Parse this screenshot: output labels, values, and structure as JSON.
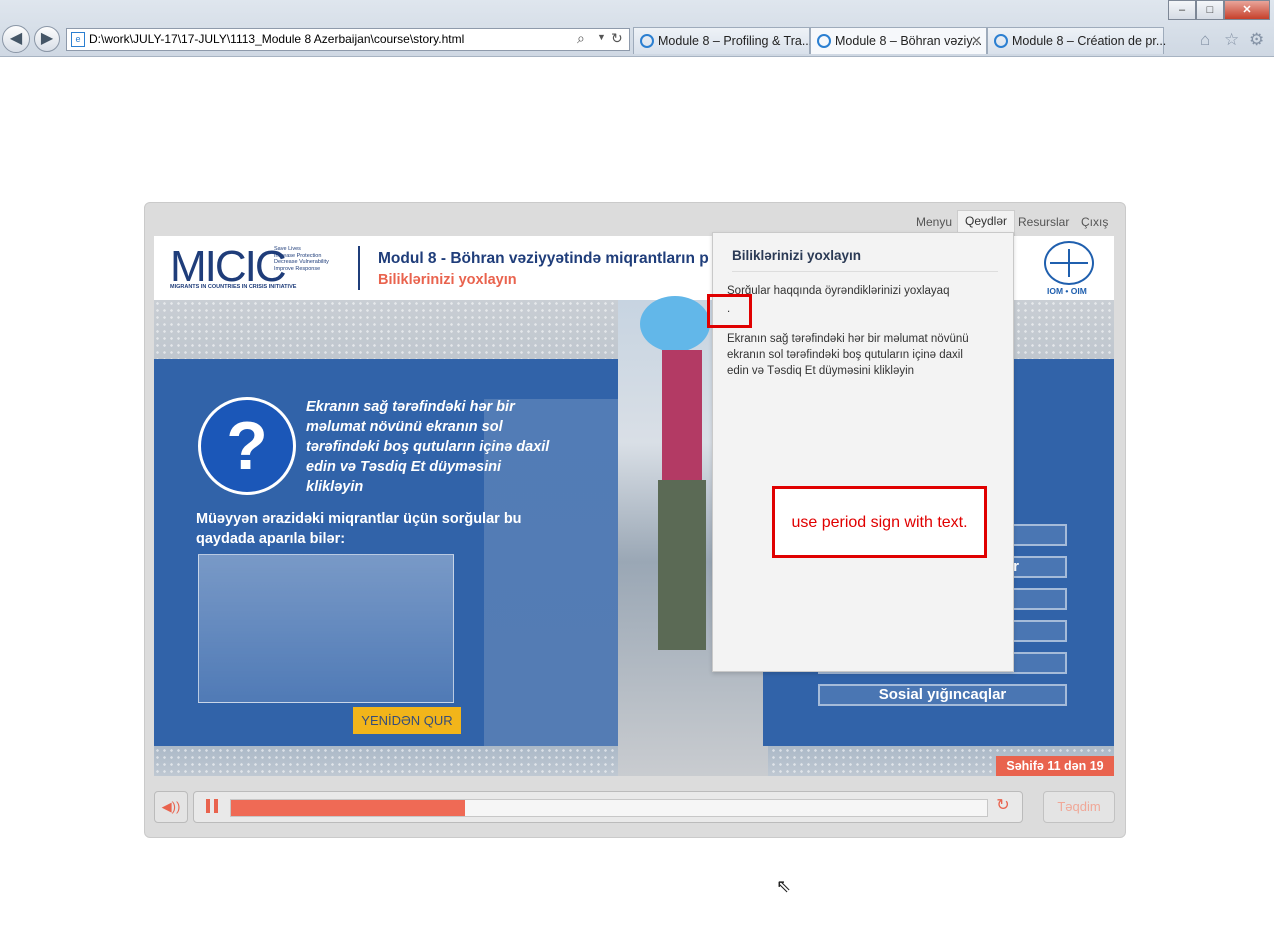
{
  "browser": {
    "address": "D:\\work\\JULY-17\\17-JULY\\1113_Module 8 Azerbaijan\\course\\story.html",
    "tabs": [
      {
        "label": "Module 8 – Profiling & Tra...",
        "active": false
      },
      {
        "label": "Module 8 – Böhran vəziy...",
        "active": true
      },
      {
        "label": "Module 8 – Création de pr...",
        "active": false
      }
    ],
    "window_buttons": {
      "minimize": "–",
      "maximize": "□",
      "close": "✕"
    }
  },
  "player_menu": {
    "menu": "Menyu",
    "notes": "Qeydlər",
    "resources": "Resurslar",
    "exit": "Çıxış"
  },
  "header": {
    "logo": "MICIC",
    "logo_sub": "MIGRANTS IN COUNTRIES IN CRISIS INITIATIVE",
    "logo_lines": [
      "Save Lives",
      "Increase Protection",
      "Decrease Vulnerability",
      "Improve Response"
    ],
    "title": "Modul 8 - Böhran vəziyyətində miqrantların p",
    "subtitle": "Biliklərinizi yoxlayın",
    "org": "IOM • OIM"
  },
  "slide": {
    "instruction": "Ekranın sağ tərəfindəki hər bir məlumat növünü ekranın sol tərəfindəki boş qutuların içinə daxil edin və Təsdiq Et düyməsini klikləyin",
    "question": "Müəyyən ərazidəki miqrantlar üçün sorğular bu qaydada aparıla bilər:",
    "reset": "YENİDƏN QUR",
    "page": "Səhifə 11 dən 19",
    "drag_items": [
      "",
      "r",
      "",
      "",
      "",
      "Sosial yığıncaqlar"
    ]
  },
  "notes": {
    "title": "Biliklərinizi yoxlayın",
    "para1": "Sorğular haqqında  öyrəndiklərinizi yoxlayaq",
    "dot": ".",
    "para2": "Ekranın sağ tərəfindəki hər bir məlumat növünü ekranın sol tərəfindəki boş qutuların içinə daxil edin və Təsdiq Et düyməsini klikləyin"
  },
  "annotation": {
    "text": "use period sign with text."
  },
  "controls": {
    "progress": 0.31,
    "submit": "Təqdim"
  },
  "colors": {
    "accent": "#ef6a55",
    "slide_blue": "#3163a9",
    "annotation_red": "#e00000"
  }
}
